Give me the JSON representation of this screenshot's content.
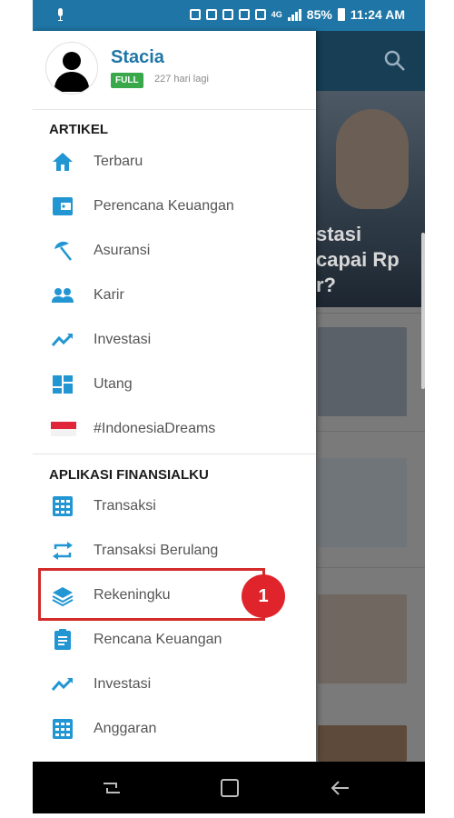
{
  "status_bar": {
    "battery": "85%",
    "time": "11:24 AM",
    "network": "4G"
  },
  "drawer": {
    "user": {
      "name": "Stacia",
      "plan_badge": "FULL",
      "plan_days": "227 hari lagi"
    },
    "sections": [
      {
        "title": "ARTIKEL",
        "items": [
          {
            "label": "Terbaru",
            "icon": "home-icon"
          },
          {
            "label": "Perencana Keuangan",
            "icon": "wallet-icon"
          },
          {
            "label": "Asuransi",
            "icon": "umbrella-icon"
          },
          {
            "label": "Karir",
            "icon": "people-icon"
          },
          {
            "label": "Investasi",
            "icon": "trending-up-icon"
          },
          {
            "label": "Utang",
            "icon": "dashboard-icon"
          },
          {
            "label": "#IndonesiaDreams",
            "icon": "indonesia-flag-icon"
          }
        ]
      },
      {
        "title": "APLIKASI FINANSIALKU",
        "items": [
          {
            "label": "Transaksi",
            "icon": "calculator-icon"
          },
          {
            "label": "Transaksi Berulang",
            "icon": "repeat-icon"
          },
          {
            "label": "Rekeningku",
            "icon": "layers-icon"
          },
          {
            "label": "Rencana Keuangan",
            "icon": "clipboard-icon"
          },
          {
            "label": "Investasi",
            "icon": "trending-up-icon"
          },
          {
            "label": "Anggaran",
            "icon": "calculator-icon"
          }
        ]
      }
    ]
  },
  "annotation": {
    "step_number": "1"
  },
  "background": {
    "hero_title": "stasi\ncapai Rp\nr?"
  },
  "colors": {
    "accent": "#1f76a6",
    "icon_blue": "#2196d3",
    "badge_green": "#38a84a",
    "highlight_red": "#d32a2a"
  }
}
